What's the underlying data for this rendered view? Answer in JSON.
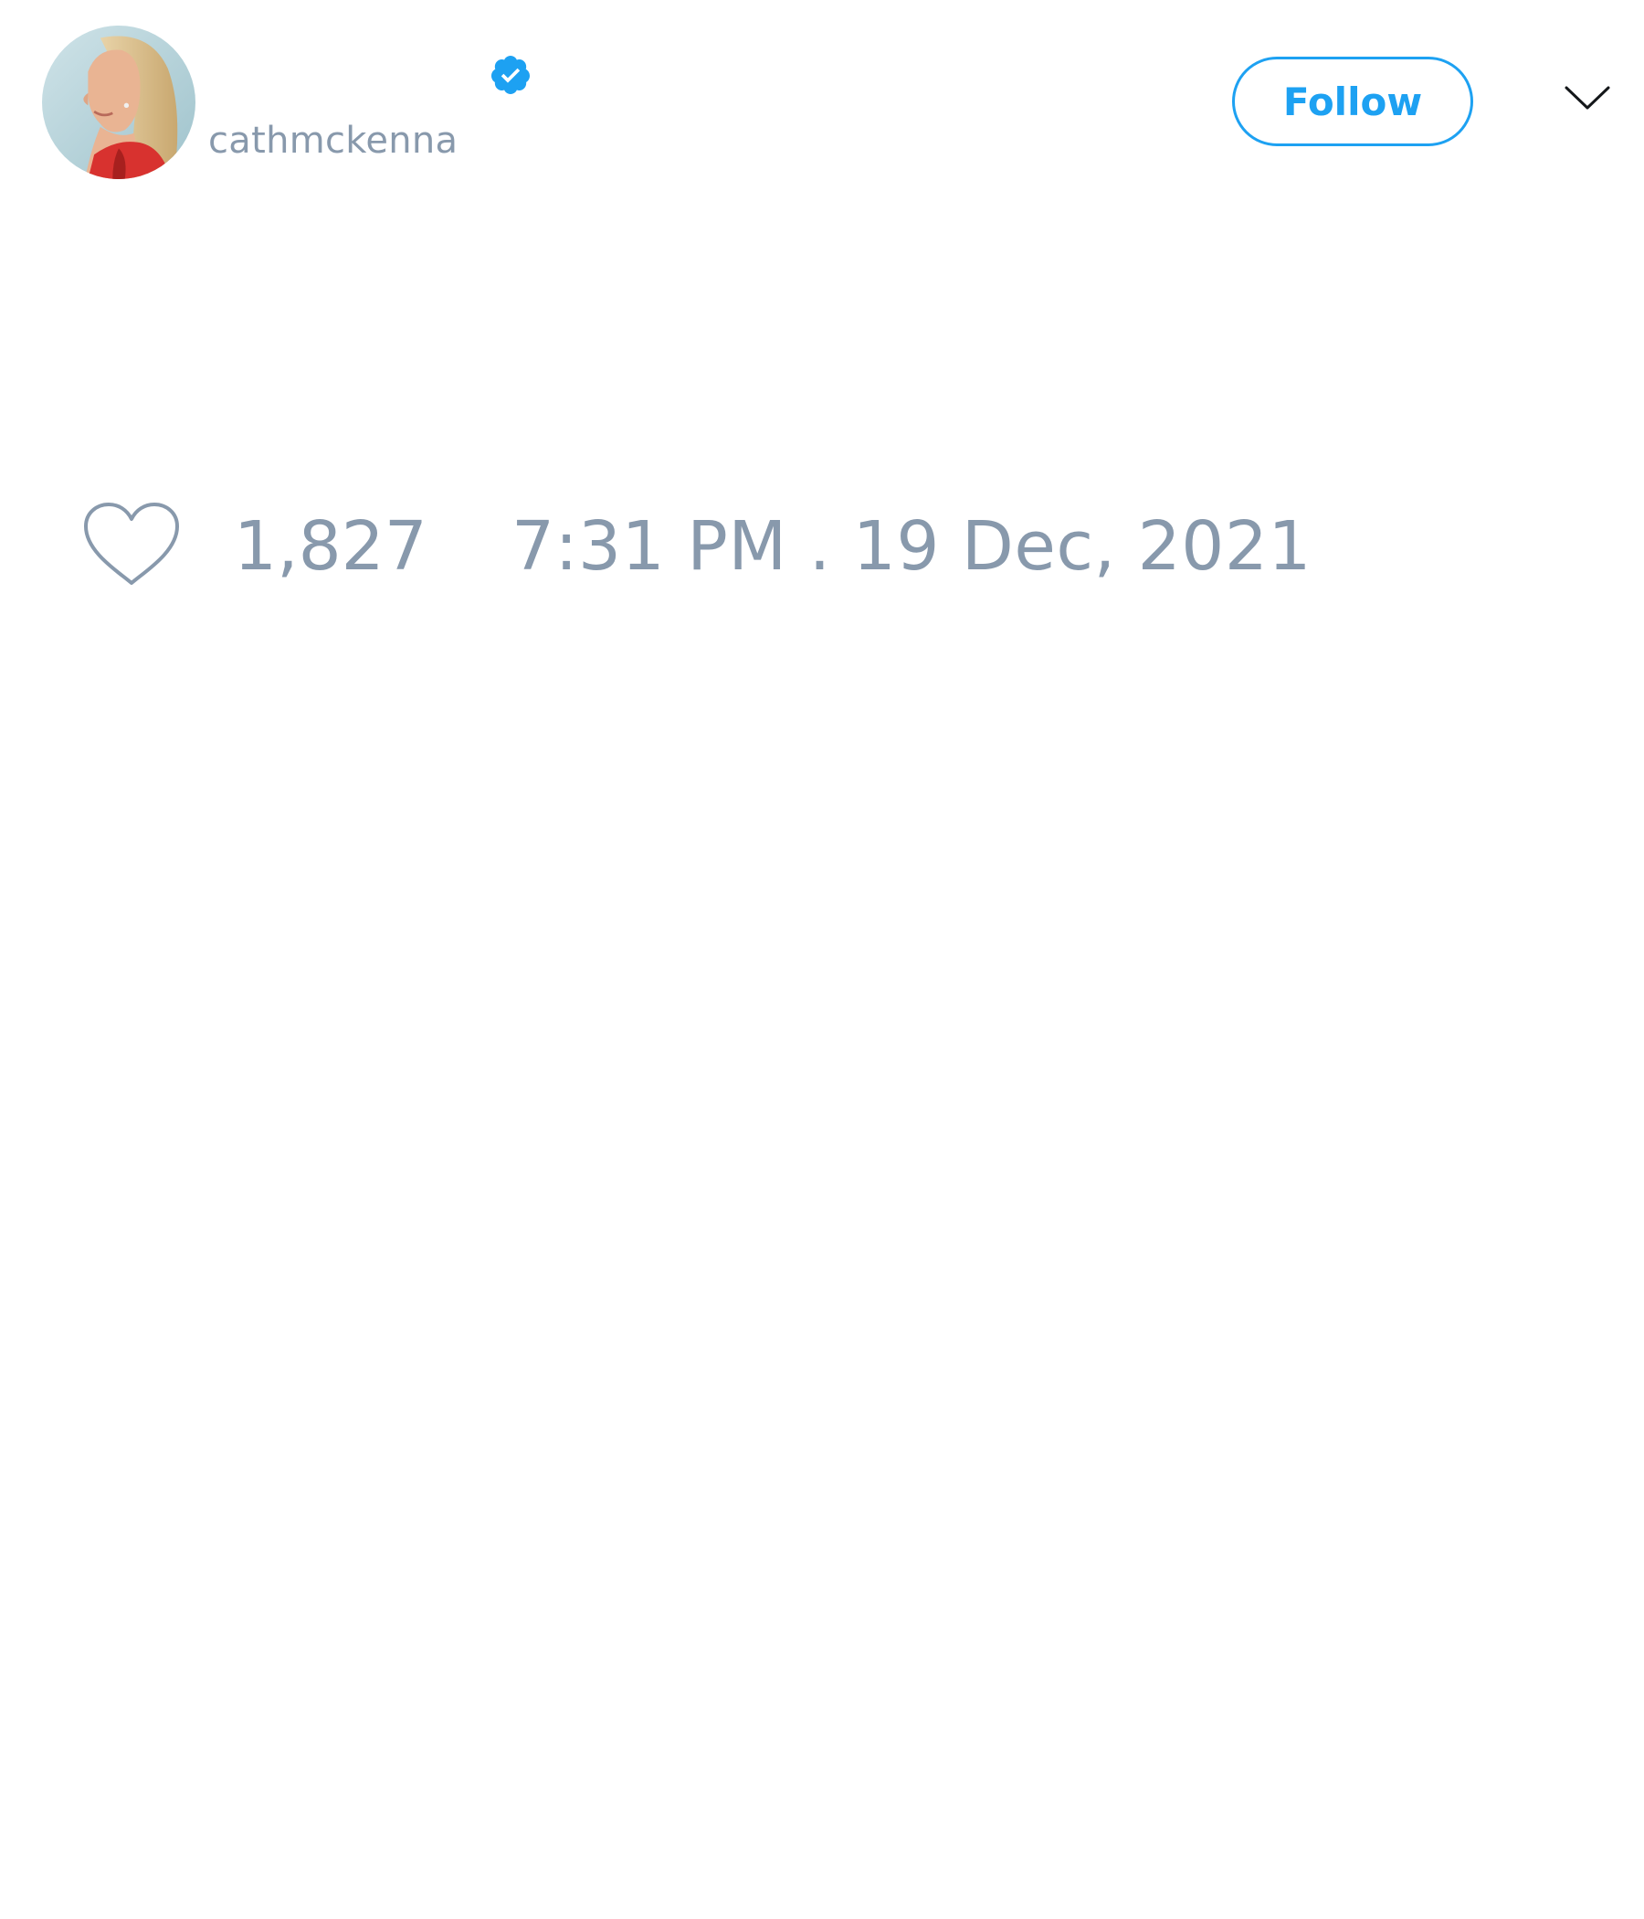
{
  "tweet": {
    "author": {
      "display_name": "",
      "handle": "cathmckenna",
      "verified": true,
      "avatar_icon": "profile-photo"
    },
    "follow_label": "Follow",
    "menu_icon": "chevron-down-icon",
    "likes": {
      "icon": "heart-outline-icon",
      "count": "1,827"
    },
    "timestamp": "7:31 PM . 19 Dec, 2021"
  },
  "colors": {
    "accent": "#1da1f2",
    "muted_text": "#8899ac",
    "background": "#ffffff"
  }
}
